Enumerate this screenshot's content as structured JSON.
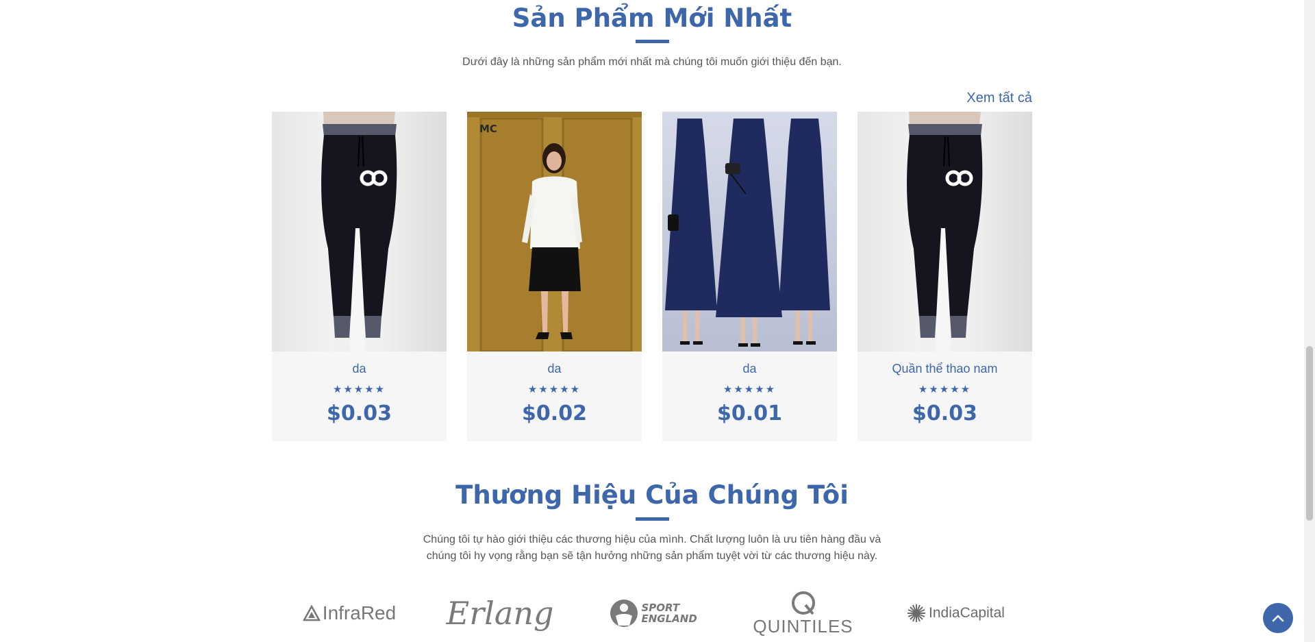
{
  "new_products": {
    "title": "Sản Phẩm Mới Nhất",
    "description": "Dưới đây là những sản phẩm mới nhất mà chúng tôi muốn giới thiệu đến bạn.",
    "view_all": "Xem tất cả",
    "products": [
      {
        "name": "da",
        "stars": "★★★★★",
        "rating": 5,
        "price": "$0.03",
        "image": "black-jogger-pants"
      },
      {
        "name": "da",
        "stars": "★★★★★",
        "rating": 5,
        "price": "$0.02",
        "image": "woman-white-shirt-black-skirt",
        "image_logo": "MC"
      },
      {
        "name": "da",
        "stars": "★★★★★",
        "rating": 5,
        "price": "$0.01",
        "image": "navy-lace-dresses"
      },
      {
        "name": "Quần thể thao nam",
        "stars": "★★★★★",
        "rating": 5,
        "price": "$0.03",
        "image": "black-jogger-pants"
      }
    ]
  },
  "brands_section": {
    "title": "Thương Hiệu Của Chúng Tôi",
    "description_line1": "Chúng tôi tự hào giới thiệu các thương hiệu của mình. Chất lượng luôn là ưu tiên hàng đầu và",
    "description_line2": "chúng tôi hy vọng rằng bạn sẽ tận hưởng những sản phẩm tuyệt vời từ các thương hiệu này.",
    "brands": [
      "InfraRed",
      "Erlang",
      "SPORT ENGLAND",
      "QUINTILES",
      "IndiaCapital"
    ]
  },
  "colors": {
    "accent": "#3d66ab",
    "text_muted": "#555555",
    "card_bg": "#f6f6f6"
  },
  "icons": {
    "scroll_top": "chevron-up-icon",
    "rating": "star-icon"
  }
}
